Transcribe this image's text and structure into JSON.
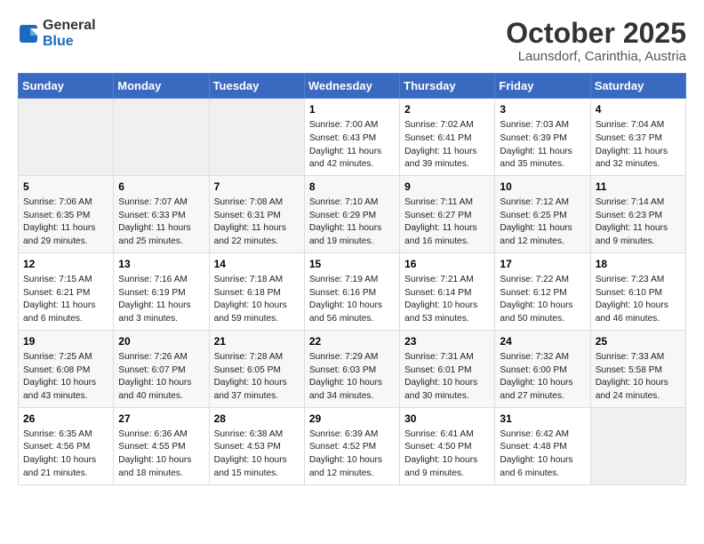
{
  "header": {
    "logo_general": "General",
    "logo_blue": "Blue",
    "month": "October 2025",
    "location": "Launsdorf, Carinthia, Austria"
  },
  "days_of_week": [
    "Sunday",
    "Monday",
    "Tuesday",
    "Wednesday",
    "Thursday",
    "Friday",
    "Saturday"
  ],
  "weeks": [
    [
      {
        "day": "",
        "info": ""
      },
      {
        "day": "",
        "info": ""
      },
      {
        "day": "",
        "info": ""
      },
      {
        "day": "1",
        "info": "Sunrise: 7:00 AM\nSunset: 6:43 PM\nDaylight: 11 hours\nand 42 minutes."
      },
      {
        "day": "2",
        "info": "Sunrise: 7:02 AM\nSunset: 6:41 PM\nDaylight: 11 hours\nand 39 minutes."
      },
      {
        "day": "3",
        "info": "Sunrise: 7:03 AM\nSunset: 6:39 PM\nDaylight: 11 hours\nand 35 minutes."
      },
      {
        "day": "4",
        "info": "Sunrise: 7:04 AM\nSunset: 6:37 PM\nDaylight: 11 hours\nand 32 minutes."
      }
    ],
    [
      {
        "day": "5",
        "info": "Sunrise: 7:06 AM\nSunset: 6:35 PM\nDaylight: 11 hours\nand 29 minutes."
      },
      {
        "day": "6",
        "info": "Sunrise: 7:07 AM\nSunset: 6:33 PM\nDaylight: 11 hours\nand 25 minutes."
      },
      {
        "day": "7",
        "info": "Sunrise: 7:08 AM\nSunset: 6:31 PM\nDaylight: 11 hours\nand 22 minutes."
      },
      {
        "day": "8",
        "info": "Sunrise: 7:10 AM\nSunset: 6:29 PM\nDaylight: 11 hours\nand 19 minutes."
      },
      {
        "day": "9",
        "info": "Sunrise: 7:11 AM\nSunset: 6:27 PM\nDaylight: 11 hours\nand 16 minutes."
      },
      {
        "day": "10",
        "info": "Sunrise: 7:12 AM\nSunset: 6:25 PM\nDaylight: 11 hours\nand 12 minutes."
      },
      {
        "day": "11",
        "info": "Sunrise: 7:14 AM\nSunset: 6:23 PM\nDaylight: 11 hours\nand 9 minutes."
      }
    ],
    [
      {
        "day": "12",
        "info": "Sunrise: 7:15 AM\nSunset: 6:21 PM\nDaylight: 11 hours\nand 6 minutes."
      },
      {
        "day": "13",
        "info": "Sunrise: 7:16 AM\nSunset: 6:19 PM\nDaylight: 11 hours\nand 3 minutes."
      },
      {
        "day": "14",
        "info": "Sunrise: 7:18 AM\nSunset: 6:18 PM\nDaylight: 10 hours\nand 59 minutes."
      },
      {
        "day": "15",
        "info": "Sunrise: 7:19 AM\nSunset: 6:16 PM\nDaylight: 10 hours\nand 56 minutes."
      },
      {
        "day": "16",
        "info": "Sunrise: 7:21 AM\nSunset: 6:14 PM\nDaylight: 10 hours\nand 53 minutes."
      },
      {
        "day": "17",
        "info": "Sunrise: 7:22 AM\nSunset: 6:12 PM\nDaylight: 10 hours\nand 50 minutes."
      },
      {
        "day": "18",
        "info": "Sunrise: 7:23 AM\nSunset: 6:10 PM\nDaylight: 10 hours\nand 46 minutes."
      }
    ],
    [
      {
        "day": "19",
        "info": "Sunrise: 7:25 AM\nSunset: 6:08 PM\nDaylight: 10 hours\nand 43 minutes."
      },
      {
        "day": "20",
        "info": "Sunrise: 7:26 AM\nSunset: 6:07 PM\nDaylight: 10 hours\nand 40 minutes."
      },
      {
        "day": "21",
        "info": "Sunrise: 7:28 AM\nSunset: 6:05 PM\nDaylight: 10 hours\nand 37 minutes."
      },
      {
        "day": "22",
        "info": "Sunrise: 7:29 AM\nSunset: 6:03 PM\nDaylight: 10 hours\nand 34 minutes."
      },
      {
        "day": "23",
        "info": "Sunrise: 7:31 AM\nSunset: 6:01 PM\nDaylight: 10 hours\nand 30 minutes."
      },
      {
        "day": "24",
        "info": "Sunrise: 7:32 AM\nSunset: 6:00 PM\nDaylight: 10 hours\nand 27 minutes."
      },
      {
        "day": "25",
        "info": "Sunrise: 7:33 AM\nSunset: 5:58 PM\nDaylight: 10 hours\nand 24 minutes."
      }
    ],
    [
      {
        "day": "26",
        "info": "Sunrise: 6:35 AM\nSunset: 4:56 PM\nDaylight: 10 hours\nand 21 minutes."
      },
      {
        "day": "27",
        "info": "Sunrise: 6:36 AM\nSunset: 4:55 PM\nDaylight: 10 hours\nand 18 minutes."
      },
      {
        "day": "28",
        "info": "Sunrise: 6:38 AM\nSunset: 4:53 PM\nDaylight: 10 hours\nand 15 minutes."
      },
      {
        "day": "29",
        "info": "Sunrise: 6:39 AM\nSunset: 4:52 PM\nDaylight: 10 hours\nand 12 minutes."
      },
      {
        "day": "30",
        "info": "Sunrise: 6:41 AM\nSunset: 4:50 PM\nDaylight: 10 hours\nand 9 minutes."
      },
      {
        "day": "31",
        "info": "Sunrise: 6:42 AM\nSunset: 4:48 PM\nDaylight: 10 hours\nand 6 minutes."
      },
      {
        "day": "",
        "info": ""
      }
    ]
  ]
}
